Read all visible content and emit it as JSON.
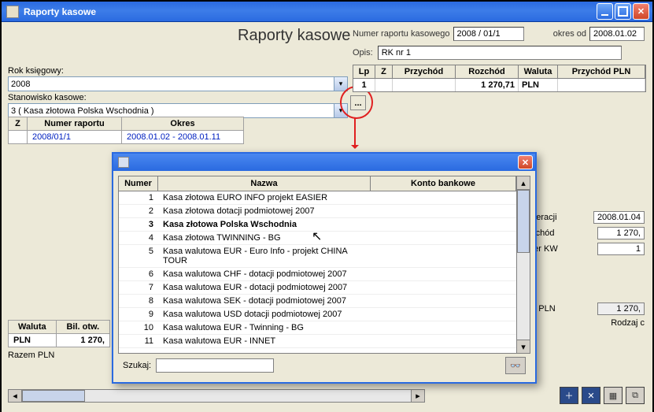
{
  "window": {
    "title": "Raporty kasowe"
  },
  "heading": "Raporty kasowe",
  "report_number": {
    "label": "Numer raportu kasowego",
    "value": "2008 / 01/1"
  },
  "period": {
    "label": "okres od",
    "value": "2008.01.02"
  },
  "opis": {
    "label": "Opis:",
    "value": "RK nr 1"
  },
  "filters": {
    "year_label": "Rok księgowy:",
    "year_value": "2008",
    "station_label": "Stanowisko kasowe:",
    "station_value": "3 ( Kasa złotowa Polska Wschodnia )",
    "ellipsis": "..."
  },
  "reports_table": {
    "headers": {
      "z": "Z",
      "num": "Numer raportu",
      "okres": "Okres"
    },
    "rows": [
      {
        "z": "",
        "num": "2008/01/1",
        "okres": "2008.01.02 - 2008.01.11"
      }
    ]
  },
  "right_grid": {
    "headers": {
      "lp": "Lp",
      "z": "Z",
      "przychod": "Przychód",
      "rozchod": "Rozchód",
      "waluta": "Waluta",
      "przychod_pln": "Przychód PLN"
    },
    "rows": [
      {
        "lp": "1",
        "z": "",
        "przychod": "",
        "rozchod": "1 270,71",
        "waluta": "PLN",
        "przychod_pln": ""
      }
    ]
  },
  "right_detail": {
    "operacji": {
      "label": "operacji",
      "value": "2008.01.04"
    },
    "ozchod": {
      "label": "ozchód",
      "value": "1 270,"
    },
    "mer_kw": {
      "label": "mer KW",
      "value": "1"
    },
    "od_pln": {
      "label": "ód PLN",
      "value": "1 270,"
    },
    "rodzaj": "Rodzaj c"
  },
  "summary": {
    "headers": {
      "waluta": "Waluta",
      "bil": "Bil. otw."
    },
    "rows": [
      {
        "waluta": "PLN",
        "bil": "1 270,"
      }
    ],
    "razem": "Razem PLN"
  },
  "modal": {
    "headers": {
      "numer": "Numer",
      "nazwa": "Nazwa",
      "konto": "Konto bankowe"
    },
    "search_label": "Szukaj:",
    "search_value": "",
    "items": [
      {
        "num": "1",
        "nazwa": "Kasa złotowa EURO INFO projekt EASIER",
        "konto": ""
      },
      {
        "num": "2",
        "nazwa": "Kasa złotowa dotacji podmiotowej 2007",
        "konto": ""
      },
      {
        "num": "3",
        "nazwa": "Kasa złotowa Polska Wschodnia",
        "konto": "",
        "selected": true
      },
      {
        "num": "4",
        "nazwa": "Kasa złotowa TWINNING - BG",
        "konto": ""
      },
      {
        "num": "5",
        "nazwa": "Kasa walutowa EUR - Euro Info - projekt CHINA TOUR",
        "konto": ""
      },
      {
        "num": "6",
        "nazwa": "Kasa walutowa CHF - dotacji podmiotowej 2007",
        "konto": ""
      },
      {
        "num": "7",
        "nazwa": "Kasa walutowa EUR - dotacji podmiotowej 2007",
        "konto": ""
      },
      {
        "num": "8",
        "nazwa": "Kasa walutowa SEK - dotacji podmiotowej 2007",
        "konto": ""
      },
      {
        "num": "9",
        "nazwa": "Kasa walutowa USD dotacji podmiotowej 2007",
        "konto": ""
      },
      {
        "num": "10",
        "nazwa": "Kasa walutowa EUR - Twinning - BG",
        "konto": ""
      },
      {
        "num": "11",
        "nazwa": "Kasa walutowa EUR - INNET",
        "konto": ""
      }
    ]
  }
}
